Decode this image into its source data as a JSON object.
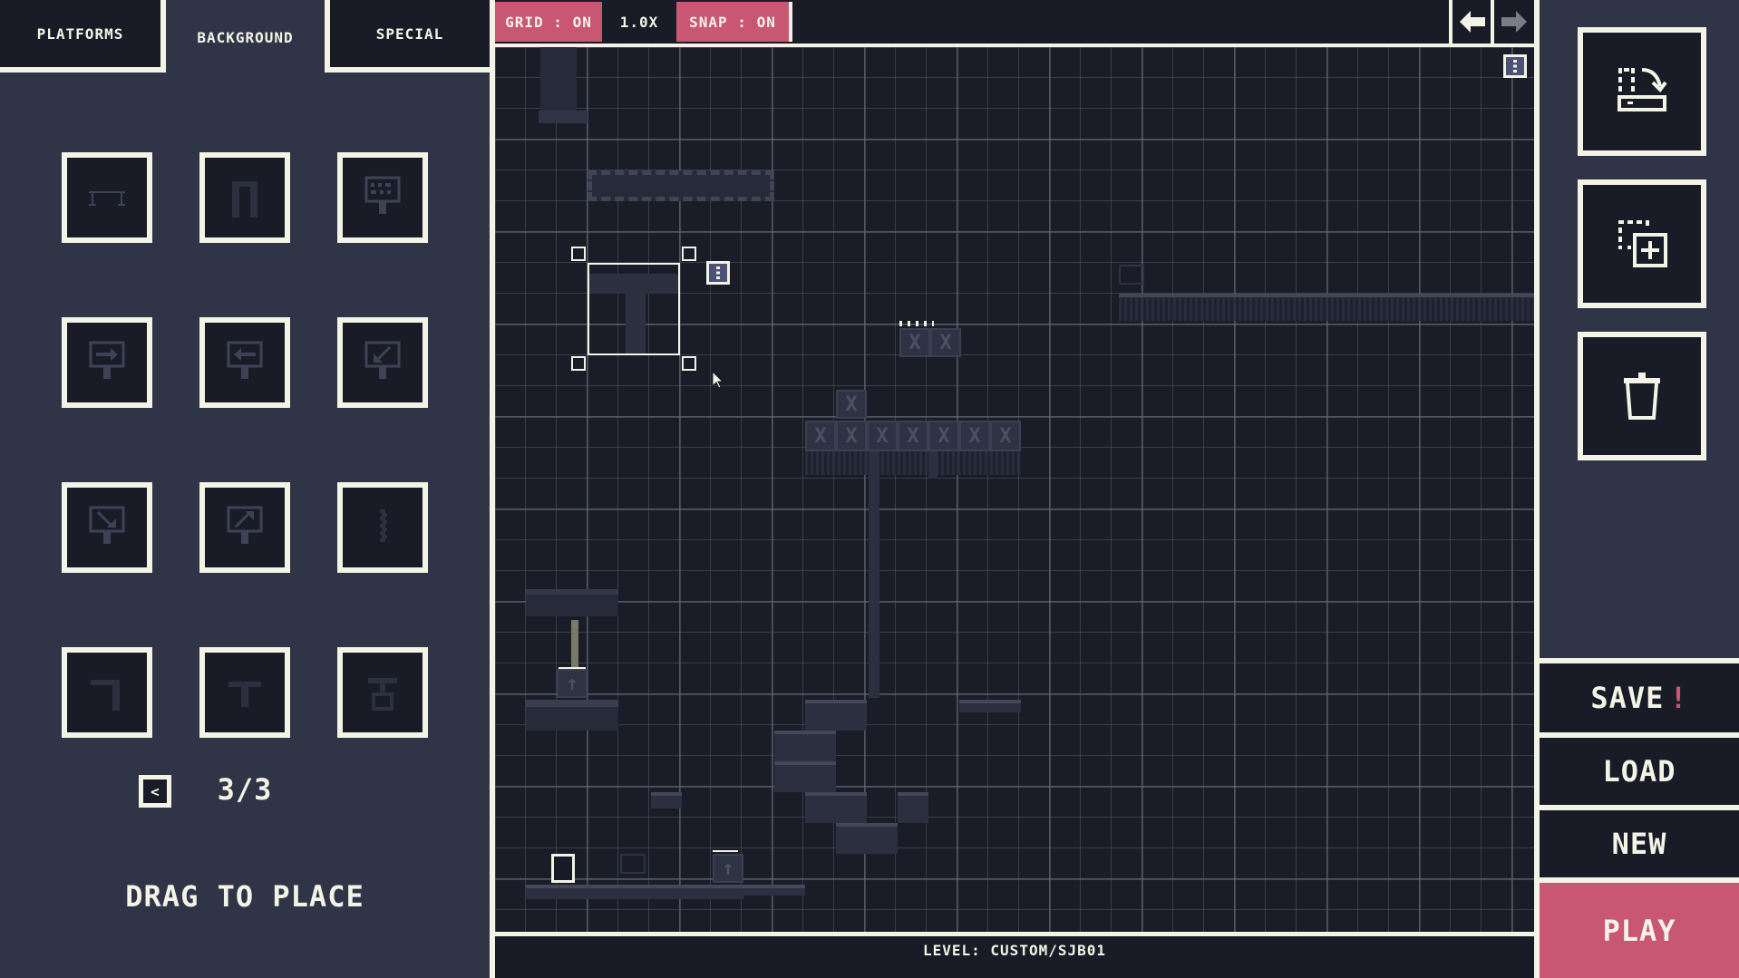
{
  "tabs": [
    {
      "label": "PLATFORMS",
      "active": false
    },
    {
      "label": "BACKGROUND",
      "active": true
    },
    {
      "label": "SPECIAL",
      "active": false
    }
  ],
  "palette": {
    "items": [
      {
        "name": "railing",
        "icon": "railing-icon"
      },
      {
        "name": "chain-arch",
        "icon": "chain-arch-icon"
      },
      {
        "name": "notice-sign",
        "icon": "notice-sign-icon"
      },
      {
        "name": "sign-arrow-right",
        "icon": "sign-arrow-right-icon"
      },
      {
        "name": "sign-arrow-left",
        "icon": "sign-arrow-left-icon"
      },
      {
        "name": "sign-arrow-down-left",
        "icon": "sign-arrow-down-left-icon"
      },
      {
        "name": "sign-arrow-down-right",
        "icon": "sign-arrow-down-right-icon"
      },
      {
        "name": "sign-arrow-up-right",
        "icon": "sign-arrow-up-right-icon"
      },
      {
        "name": "chain-vertical",
        "icon": "chain-vertical-icon"
      },
      {
        "name": "chain-corner",
        "icon": "chain-corner-icon"
      },
      {
        "name": "chain-tee",
        "icon": "chain-tee-icon"
      },
      {
        "name": "chain-lock",
        "icon": "chain-lock-icon"
      }
    ],
    "page": "3/3",
    "prev_label": "<",
    "hint": "DRAG TO PLACE"
  },
  "toolbar": {
    "grid_label": "GRID : ON",
    "zoom_label": "1.0X",
    "snap_label": "SNAP : ON",
    "undo_icon": "arrow-left-icon",
    "redo_icon": "arrow-right-icon",
    "redo_enabled": false
  },
  "canvas": {
    "level_label": "LEVEL: CUSTOM/SJB01",
    "selection": "chain-tee",
    "menu_icon": "vertical-dots-icon"
  },
  "tools": [
    {
      "name": "import",
      "icon": "import-icon"
    },
    {
      "name": "duplicate",
      "icon": "duplicate-icon"
    },
    {
      "name": "delete",
      "icon": "trash-icon"
    }
  ],
  "actions": {
    "save_label": "SAVE",
    "save_unsaved_marker": "!",
    "load_label": "LOAD",
    "new_label": "NEW",
    "play_label": "PLAY"
  },
  "colors": {
    "accent": "#c95774",
    "panel": "#2f3447",
    "dark": "#191c26",
    "cream": "#f3f3e6"
  }
}
